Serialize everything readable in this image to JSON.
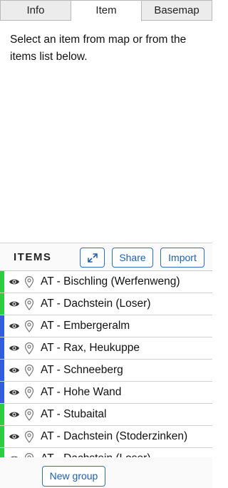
{
  "tabs": [
    {
      "label": "Info",
      "active": false
    },
    {
      "label": "Item",
      "active": true
    },
    {
      "label": "Basemap",
      "active": false
    }
  ],
  "item_panel": {
    "hint": "Select an item from map or from the items list below."
  },
  "items_panel": {
    "title": "ITEMS",
    "share_label": "Share",
    "import_label": "Import",
    "expand_icon": "expand-arrows-icon",
    "new_group_label": "New group"
  },
  "items": [
    {
      "label": "AT - Bischling (Werfenweng)",
      "color": "#2ecc40"
    },
    {
      "label": "AT - Dachstein (Loser)",
      "color": "#2ecc40"
    },
    {
      "label": "AT - Embergeralm",
      "color": "#2f5fe0"
    },
    {
      "label": "AT - Rax, Heukuppe",
      "color": "#2f5fe0"
    },
    {
      "label": "AT - Schneeberg",
      "color": "#2f5fe0"
    },
    {
      "label": "AT - Hohe Wand",
      "color": "#2f5fe0"
    },
    {
      "label": "AT - Stubaital",
      "color": "#2ecc40"
    },
    {
      "label": "AT - Dachstein (Stoderzinken)",
      "color": "#2ecc40"
    },
    {
      "label": "AT - Dachstein (Loser)",
      "color": "#2ecc40"
    }
  ],
  "colors": {
    "accent": "#1d5fb4",
    "green_group": "#2ecc40",
    "blue_group": "#2f5fe0"
  }
}
